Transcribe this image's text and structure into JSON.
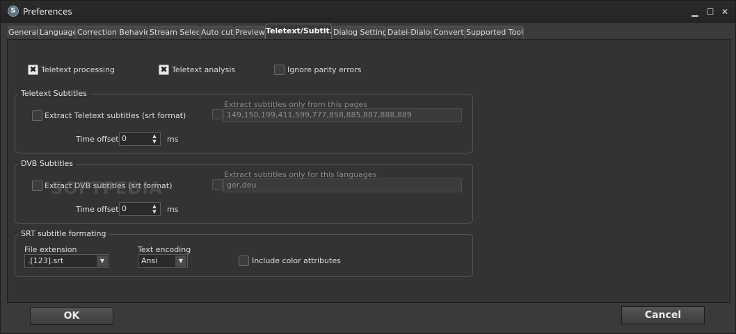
{
  "window": {
    "title": "Preferences",
    "app_icon_glyph": "S",
    "minimize_glyph": "▁",
    "maximize_glyph": "☐",
    "close_glyph": "✕"
  },
  "tabs": [
    {
      "label": "General"
    },
    {
      "label": "Language"
    },
    {
      "label": "Correction Behavior"
    },
    {
      "label": "Stream Select"
    },
    {
      "label": "Auto cut"
    },
    {
      "label": "Preview"
    },
    {
      "label": "Teletext/Subtit...",
      "active": true
    },
    {
      "label": "Dialog Settings"
    },
    {
      "label": "Datei-Dialog"
    },
    {
      "label": "Convert"
    },
    {
      "label": "Supported Tools"
    }
  ],
  "options": {
    "teletext_processing": {
      "label": "Teletext processing",
      "checked": true
    },
    "teletext_analysis": {
      "label": "Teletext analysis",
      "checked": true
    },
    "ignore_parity": {
      "label": "Ignore parity errors",
      "checked": false
    }
  },
  "teletext_subtitles": {
    "title": "Teletext Subtitles",
    "extract_label": "Extract Teletext subtitles (srt format)",
    "pages_label": "Extract subtitles only from this pages",
    "pages_value": "149,150,199,411,599,777,858,885,887,888,889",
    "time_offset_label": "Time offset",
    "time_offset_value": "0",
    "unit": "ms"
  },
  "dvb_subtitles": {
    "title": "DVB Subtitles",
    "extract_label": "Extract DVB subtitles (srt format)",
    "languages_label": "Extract subtitles only for this languages",
    "languages_value": "ger,deu",
    "time_offset_label": "Time offset",
    "time_offset_value": "0",
    "unit": "ms"
  },
  "srt_formatting": {
    "title": "SRT subtitle formating",
    "file_extension_label": "File extension",
    "file_extension_value": ".[123].srt",
    "text_encoding_label": "Text encoding",
    "text_encoding_value": "Ansi",
    "color_attributes_label": "Include color attributes"
  },
  "buttons": {
    "ok": "OK",
    "cancel": "Cancel"
  },
  "watermark": "SOFTPEDIA"
}
